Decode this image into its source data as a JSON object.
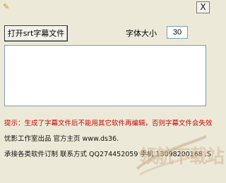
{
  "window": {
    "close_label": "X"
  },
  "toolbar": {
    "open_button_label": "打开srt字幕文件",
    "font_size_label": "字体大小",
    "font_size_value": "30"
  },
  "footer": {
    "tip": "提示：生成了字幕文件后不能用其它软件再编辑，否则字幕文件会失效",
    "studio": "忧影工作室出品 官方主页 www.ds36.",
    "contact": "承接各类软件订制 联系方式 QQ274452059 手机 13098200168 .S"
  },
  "watermark": {
    "text": "领航下载站"
  }
}
